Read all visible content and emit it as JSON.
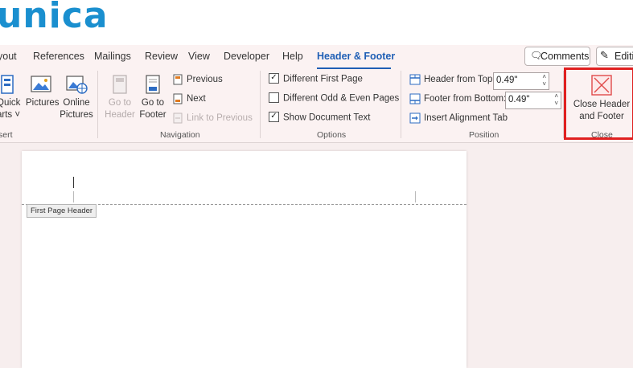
{
  "logo": {
    "text": "unica"
  },
  "tabs": [
    {
      "label": "yout"
    },
    {
      "label": "References"
    },
    {
      "label": "Mailings"
    },
    {
      "label": "Review"
    },
    {
      "label": "View"
    },
    {
      "label": "Developer"
    },
    {
      "label": "Help"
    },
    {
      "label": "Header & Footer",
      "active": true
    }
  ],
  "comments_label": "Comments",
  "editing_label": "Editi",
  "insert_group": {
    "quick_parts": "Quick\narts ˅",
    "pictures": "Pictures",
    "online_pictures": "Online\nPictures",
    "label": "sert"
  },
  "navigation": {
    "goto_header": "Go to\nHeader",
    "goto_footer": "Go to\nFooter",
    "previous": "Previous",
    "next": "Next",
    "link_previous": "Link to Previous",
    "label": "Navigation"
  },
  "options": {
    "different_first_page": {
      "label": "Different First Page",
      "checked": true
    },
    "different_odd_even": {
      "label": "Different Odd & Even Pages",
      "checked": false
    },
    "show_document_text": {
      "label": "Show Document Text",
      "checked": true
    },
    "label": "Options"
  },
  "position": {
    "header_from_top_label": "Header from Top:",
    "header_from_top_value": "0.49\"",
    "footer_from_bottom_label": "Footer from Bottom:",
    "footer_from_bottom_value": "0.49\"",
    "insert_alignment_tab": "Insert Alignment Tab",
    "label": "Position"
  },
  "close_group": {
    "close_button": "Close Header\nand Footer",
    "label": "Close",
    "highlight_color": "#e02020"
  },
  "document": {
    "header_tag": "First Page Header"
  },
  "colors": {
    "logo_blue": "#1a8fcf",
    "logo_accent": "#e8402e",
    "active_tab": "#1f5fb5"
  }
}
